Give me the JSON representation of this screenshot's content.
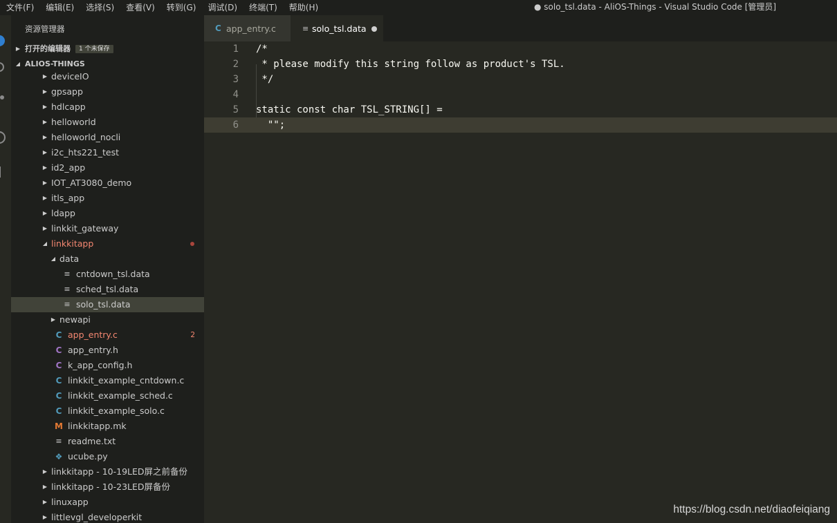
{
  "menu": [
    "文件(F)",
    "编辑(E)",
    "选择(S)",
    "查看(V)",
    "转到(G)",
    "调试(D)",
    "终端(T)",
    "帮助(H)"
  ],
  "window_title": "● solo_tsl.data - AliOS-Things - Visual Studio Code [管理员]",
  "sidebar": {
    "title": "资源管理器",
    "open_editors": {
      "label": "打开的编辑器",
      "badge": "1 个未保存"
    },
    "workspace": {
      "label": "ALIOS-THINGS"
    },
    "tree": [
      {
        "label": "deviceIO",
        "kind": "folder",
        "depth": 0
      },
      {
        "label": "gpsapp",
        "kind": "folder",
        "depth": 0
      },
      {
        "label": "hdlcapp",
        "kind": "folder",
        "depth": 0
      },
      {
        "label": "helloworld",
        "kind": "folder",
        "depth": 0
      },
      {
        "label": "helloworld_nocli",
        "kind": "folder",
        "depth": 0
      },
      {
        "label": "i2c_hts221_test",
        "kind": "folder",
        "depth": 0
      },
      {
        "label": "id2_app",
        "kind": "folder",
        "depth": 0
      },
      {
        "label": "IOT_AT3080_demo",
        "kind": "folder",
        "depth": 0
      },
      {
        "label": "itls_app",
        "kind": "folder",
        "depth": 0
      },
      {
        "label": "ldapp",
        "kind": "folder",
        "depth": 0
      },
      {
        "label": "linkkit_gateway",
        "kind": "folder",
        "depth": 0
      },
      {
        "label": "linkkitapp",
        "kind": "folder-open",
        "depth": 0,
        "error": true,
        "dot": true
      },
      {
        "label": "data",
        "kind": "folder-open",
        "depth": 1
      },
      {
        "label": "cntdown_tsl.data",
        "kind": "text",
        "depth": 2
      },
      {
        "label": "sched_tsl.data",
        "kind": "text",
        "depth": 2
      },
      {
        "label": "solo_tsl.data",
        "kind": "text",
        "depth": 2,
        "selected": true
      },
      {
        "label": "newapi",
        "kind": "folder",
        "depth": 1
      },
      {
        "label": "app_entry.c",
        "kind": "c",
        "depth": 1,
        "error": true,
        "badge": "2"
      },
      {
        "label": "app_entry.h",
        "kind": "h",
        "depth": 1
      },
      {
        "label": "k_app_config.h",
        "kind": "h",
        "depth": 1
      },
      {
        "label": "linkkit_example_cntdown.c",
        "kind": "c",
        "depth": 1
      },
      {
        "label": "linkkit_example_sched.c",
        "kind": "c",
        "depth": 1
      },
      {
        "label": "linkkit_example_solo.c",
        "kind": "c",
        "depth": 1
      },
      {
        "label": "linkkitapp.mk",
        "kind": "mk",
        "depth": 1
      },
      {
        "label": "readme.txt",
        "kind": "text",
        "depth": 1
      },
      {
        "label": "ucube.py",
        "kind": "py",
        "depth": 1
      },
      {
        "label": "linkkitapp - 10-19LED屏之前备份",
        "kind": "folder",
        "depth": 0
      },
      {
        "label": "linkkitapp - 10-23LED屏备份",
        "kind": "folder",
        "depth": 0
      },
      {
        "label": "linuxapp",
        "kind": "folder",
        "depth": 0
      },
      {
        "label": "littlevgl_developerkit",
        "kind": "folder",
        "depth": 0
      }
    ]
  },
  "tabs": [
    {
      "label": "app_entry.c",
      "icon": "c-file-icon",
      "active": false
    },
    {
      "label": "solo_tsl.data",
      "icon": "text-file-icon",
      "active": true,
      "dirty": true
    }
  ],
  "editor": {
    "current_line": 6,
    "lines": [
      {
        "n": "1",
        "text": "/*"
      },
      {
        "n": "2",
        "text": " * please modify this string follow as product's TSL."
      },
      {
        "n": "3",
        "text": " */"
      },
      {
        "n": "4",
        "text": ""
      },
      {
        "n": "5",
        "text": "static const char TSL_STRING[] ="
      },
      {
        "n": "6",
        "text": "  \"\";"
      }
    ]
  },
  "colors": {
    "c_icon": "#519aba",
    "h_icon": "#a074c4",
    "mk_icon": "#e37933",
    "py_icon": "#519aba",
    "error": "#f48771"
  },
  "watermark": "https://blog.csdn.net/diaofeiqiang"
}
